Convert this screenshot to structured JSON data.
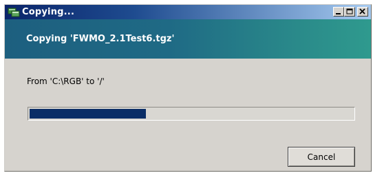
{
  "window": {
    "title": "Copying...",
    "icon": "copy-files-icon",
    "controls": [
      "minimize-icon",
      "maximize-icon",
      "close-icon"
    ]
  },
  "banner": {
    "text": "Copying 'FWMO_2.1Test6.tgz'"
  },
  "details": {
    "from_to": "From 'C:\\RGB' to '/'"
  },
  "progress": {
    "fraction": 0.36
  },
  "buttons": {
    "cancel_label": "Cancel"
  },
  "colors": {
    "titlebar_start": "#0a246a",
    "titlebar_end": "#a6caf0",
    "banner_start": "#1d5f7f",
    "banner_end": "#2f9a8e",
    "progress_fill": "#0a2d66",
    "dialog_bg": "#d6d3ce"
  }
}
